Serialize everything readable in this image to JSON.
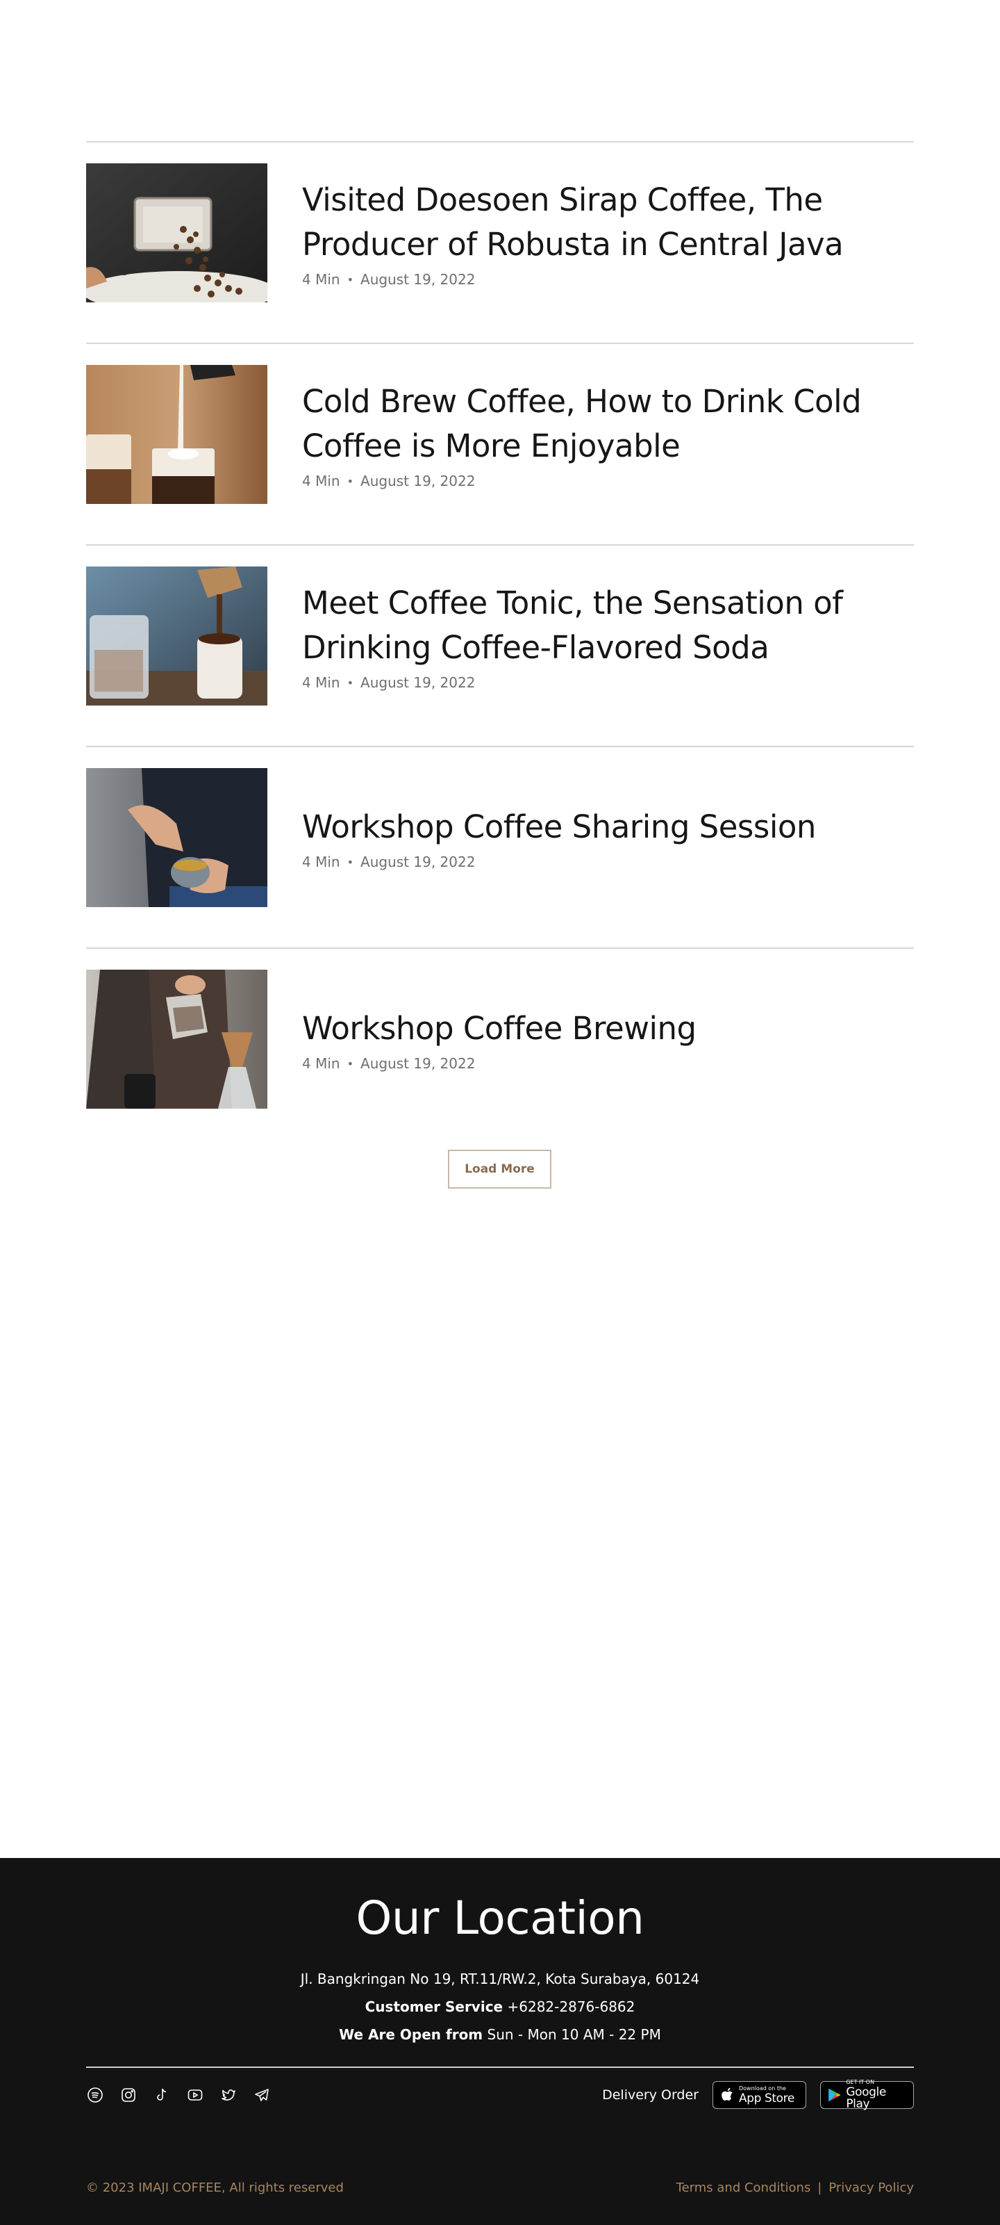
{
  "articles": [
    {
      "title": "Visited Doesoen Sirap Coffee, The Producer of Robusta in Central Java",
      "read_time": "4 Min",
      "separator": "•",
      "date": "August 19, 2022",
      "thumbnail": "coffee-roaster-beans"
    },
    {
      "title": "Cold Brew Coffee, How to Drink Cold Coffee is More Enjoyable",
      "read_time": "4 Min",
      "separator": "•",
      "date": "August 19, 2022",
      "thumbnail": "iced-latte-pour"
    },
    {
      "title": "Meet Coffee Tonic, the Sensation of Drinking Coffee-Flavored Soda",
      "read_time": "4 Min",
      "separator": "•",
      "date": "August 19, 2022",
      "thumbnail": "coffee-pour-cup"
    },
    {
      "title": "Workshop Coffee Sharing Session",
      "read_time": "4 Min",
      "separator": "•",
      "date": "August 19, 2022",
      "thumbnail": "barista-bowl"
    },
    {
      "title": "Workshop Coffee Brewing",
      "read_time": "4 Min",
      "separator": "•",
      "date": "August 19, 2022",
      "thumbnail": "chemex-brewing"
    }
  ],
  "load_more_label": "Load More",
  "footer": {
    "title": "Our Location",
    "address": "Jl. Bangkringan No 19, RT.11/RW.2, Kota Surabaya, 60124",
    "customer_service_label": "Customer Service",
    "customer_service_value": "+6282-2876-6862",
    "open_label": "We Are Open from",
    "open_value": "Sun - Mon 10 AM - 22 PM",
    "socials": [
      "spotify-icon",
      "instagram-icon",
      "tiktok-icon",
      "youtube-icon",
      "twitter-icon",
      "telegram-icon"
    ],
    "delivery_label": "Delivery Order",
    "app_store": {
      "small": "Download on the",
      "big": "App Store"
    },
    "google_play": {
      "small": "GET IT ON",
      "big": "Google Play"
    },
    "copyright": "© 2023 IMAJI COFFEE, All rights reserved",
    "terms": "Terms and Conditions",
    "legal_separator": "|",
    "privacy": "Privacy Policy"
  },
  "colors": {
    "footer_bg": "#131313",
    "accent_brown": "#a8855f",
    "load_more_text": "#8a6a4f"
  }
}
